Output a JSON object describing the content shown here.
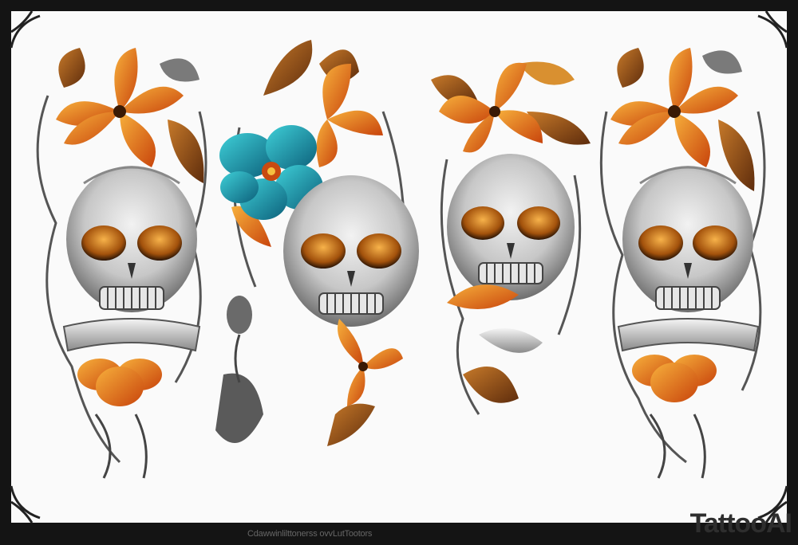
{
  "image": {
    "caption": "Cdawwinlilttonerss ovvLutTootors",
    "watermark": "TattooAI",
    "palette": {
      "background": "#fafafa",
      "frame": "#141414",
      "bone": "#d9d9d9",
      "shadow": "#3a3a3a",
      "orange": "#e8780f",
      "amber": "#f2a33a",
      "rust": "#b8400e",
      "teal": "#1aa6b7",
      "leaf": "#8a4a1c"
    }
  }
}
